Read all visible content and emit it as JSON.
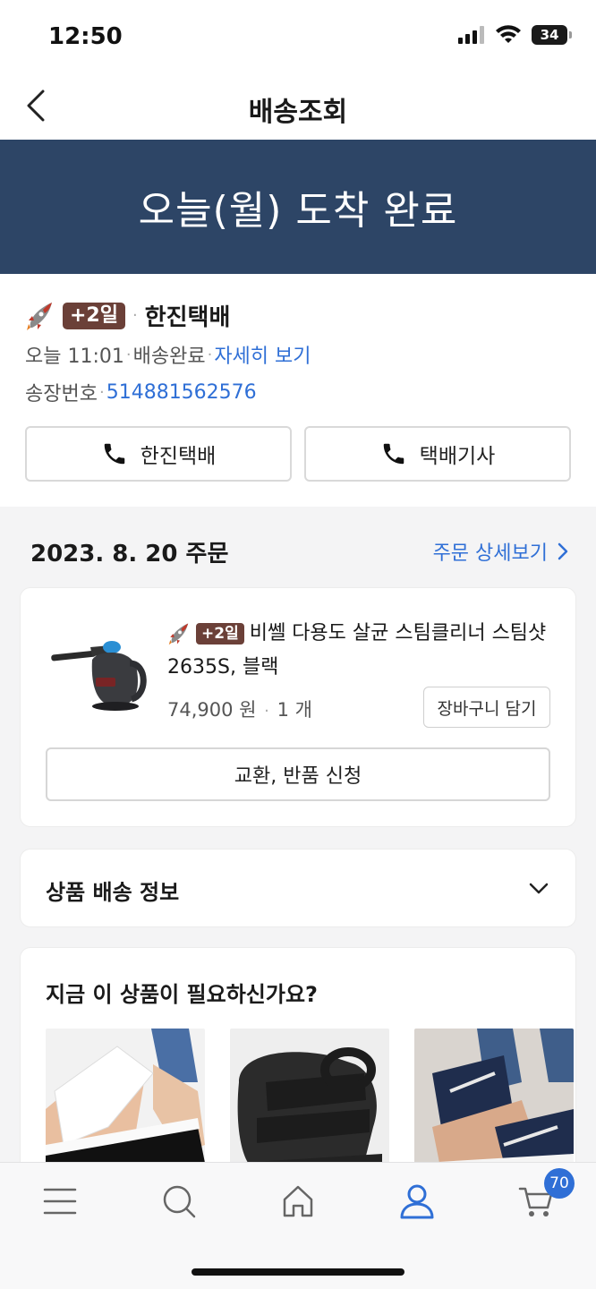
{
  "status_bar": {
    "time": "12:50",
    "battery": "34"
  },
  "nav": {
    "title": "배송조회"
  },
  "hero": {
    "title": "오늘(월) 도착 완료"
  },
  "delivery": {
    "badge": "+2일",
    "carrier": "한진택배",
    "time": "오늘 11:01",
    "status": "배송완료",
    "detail_link": "자세히 보기",
    "tracking_label": "송장번호",
    "tracking_number": "514881562576",
    "call_carrier_label": "한진택배",
    "call_driver_label": "택배기사"
  },
  "order": {
    "date": "2023. 8. 20 주문",
    "detail_link": "주문 상세보기",
    "product": {
      "badge": "+2일",
      "name": "비쎌 다용도 살균 스팀클리너 스팀샷 2635S, 블랙",
      "price": "74,900 원",
      "quantity": "1 개",
      "cart_button": "장바구니 담기",
      "exchange_button": "교환, 반품 신청"
    }
  },
  "shipping_info": {
    "title": "상품 배송 정보"
  },
  "recommend": {
    "title": "지금 이 상품이 필요하신가요?"
  },
  "tab_bar": {
    "cart_count": "70",
    "active": "my-page"
  },
  "colors": {
    "hero_bg": "#2d4566",
    "accent": "#2f6fd6",
    "badge": "#6b4038"
  }
}
